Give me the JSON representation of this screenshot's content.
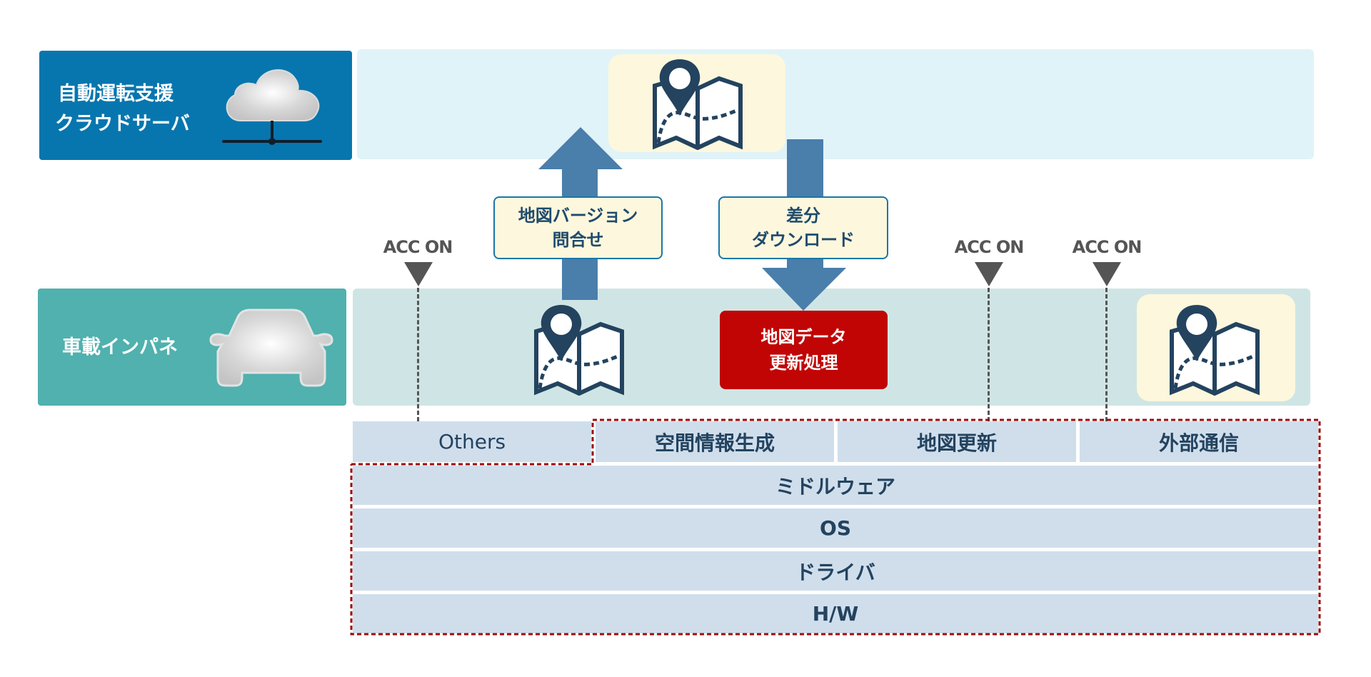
{
  "cloud": {
    "title_line1": "自動運転支援",
    "title_line2": "クラウドサーバ",
    "icon": "cloud-server-icon",
    "color": "#0776ae",
    "band_color": "#e0f3f8"
  },
  "vehicle": {
    "title": "車載インパネ",
    "icon": "car-icon",
    "color": "#50b1ae",
    "band_color": "#cfe5e5"
  },
  "flows": {
    "query_label_line1": "地図バージョン",
    "query_label_line2": "問合せ",
    "download_label_line1": "差分",
    "download_label_line2": "ダウンロード",
    "arrow_color": "#4a7eab"
  },
  "process": {
    "label_line1": "地図データ",
    "label_line2": "更新処理",
    "color": "#c10505"
  },
  "acc_markers": [
    {
      "label": "ACC ON"
    },
    {
      "label": "ACC ON"
    },
    {
      "label": "ACC ON"
    }
  ],
  "software_stack": {
    "apps": [
      "Others",
      "空間情報生成",
      "地図更新",
      "外部通信"
    ],
    "layers": [
      "ミドルウェア",
      "OS",
      "ドライバ",
      "H/W"
    ],
    "highlight_color": "#9b0b0b"
  },
  "icons": {
    "map": "map-pin-icon"
  }
}
